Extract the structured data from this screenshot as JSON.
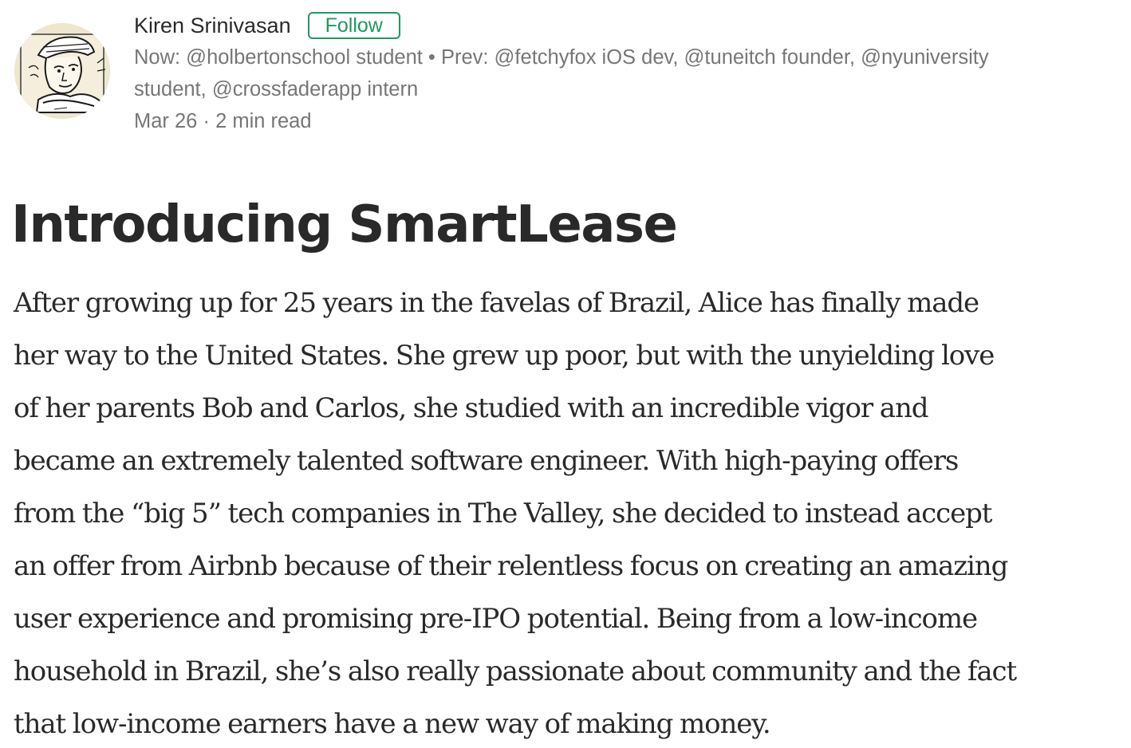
{
  "author": {
    "name": "Kiren Srinivasan",
    "follow_label": "Follow",
    "bio_line_1": "Now: @holbertonschool student • Prev: @fetchyfox iOS dev, @tuneitch founder, @nyuniversity",
    "bio_line_2": "student, @crossfaderapp intern"
  },
  "post": {
    "date": "Mar 26",
    "separator": "·",
    "read_time": "2 min read",
    "title": "Introducing SmartLease",
    "body_lines": [
      "After growing up for 25 years in the favelas of Brazil, Alice has finally made",
      "her way to the United States. She grew up poor, but with the unyielding love",
      "of her parents Bob and Carlos, she studied with an incredible vigor and",
      "became an extremely talented software engineer. With high-paying offers",
      "from the “big 5” tech companies in The Valley, she decided to instead accept",
      "an offer from Airbnb because of their relentless focus on creating an amazing",
      "user experience and promising pre-IPO potential. Being from a low-income",
      "household in Brazil, she’s also really passionate about community and the fact",
      "that low-income earners have a new way of making money."
    ]
  },
  "colors": {
    "follow_accent": "#1c9963",
    "text_primary": "rgba(0,0,0,0.84)",
    "text_secondary": "rgba(0,0,0,0.54)"
  }
}
